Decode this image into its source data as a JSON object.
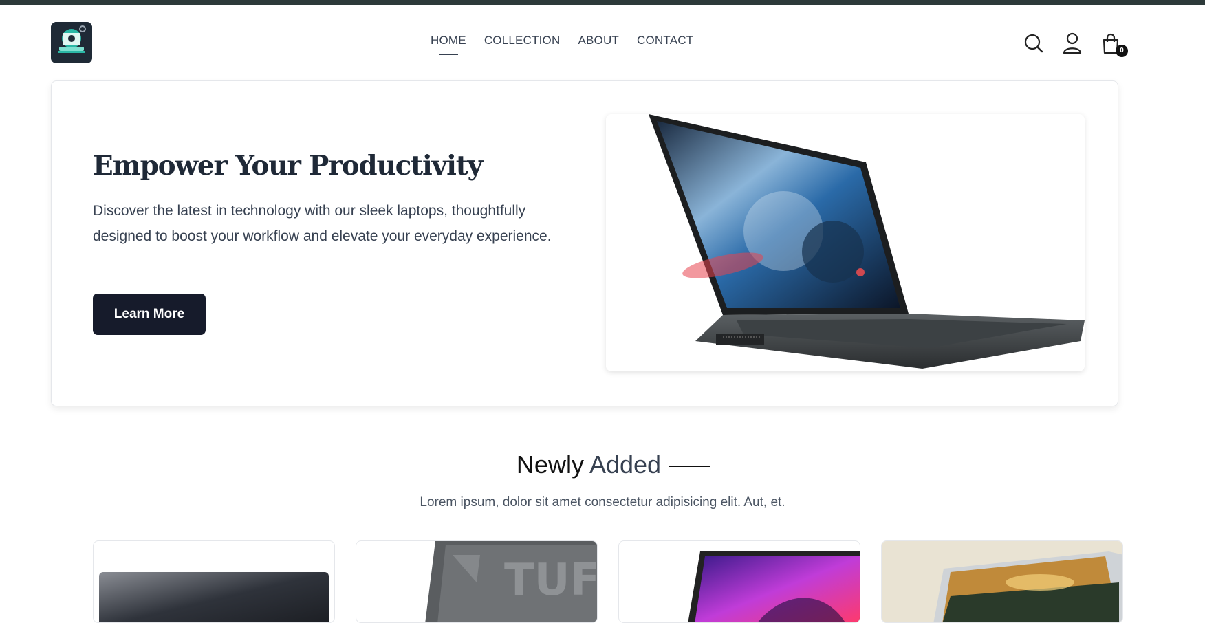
{
  "nav": {
    "items": [
      {
        "label": "HOME",
        "active": true
      },
      {
        "label": "COLLECTION",
        "active": false
      },
      {
        "label": "ABOUT",
        "active": false
      },
      {
        "label": "CONTACT",
        "active": false
      }
    ]
  },
  "header": {
    "cart_count": "0"
  },
  "hero": {
    "title": "Empower Your Productivity",
    "description": "Discover the latest in technology with our sleek laptops, thoughtfully designed to boost your workflow and elevate your everyday experience.",
    "cta_label": "Learn More"
  },
  "section": {
    "title_part1": "Newly",
    "title_part2": "Added",
    "subtitle": "Lorem ipsum, dolor sit amet consectetur adipisicing elit. Aut, et."
  },
  "icons": {
    "search": "search-icon",
    "account": "user-icon",
    "cart": "shopping-bag-icon"
  },
  "colors": {
    "accent": "#161b2b",
    "topbar": "#2d3a3a"
  }
}
